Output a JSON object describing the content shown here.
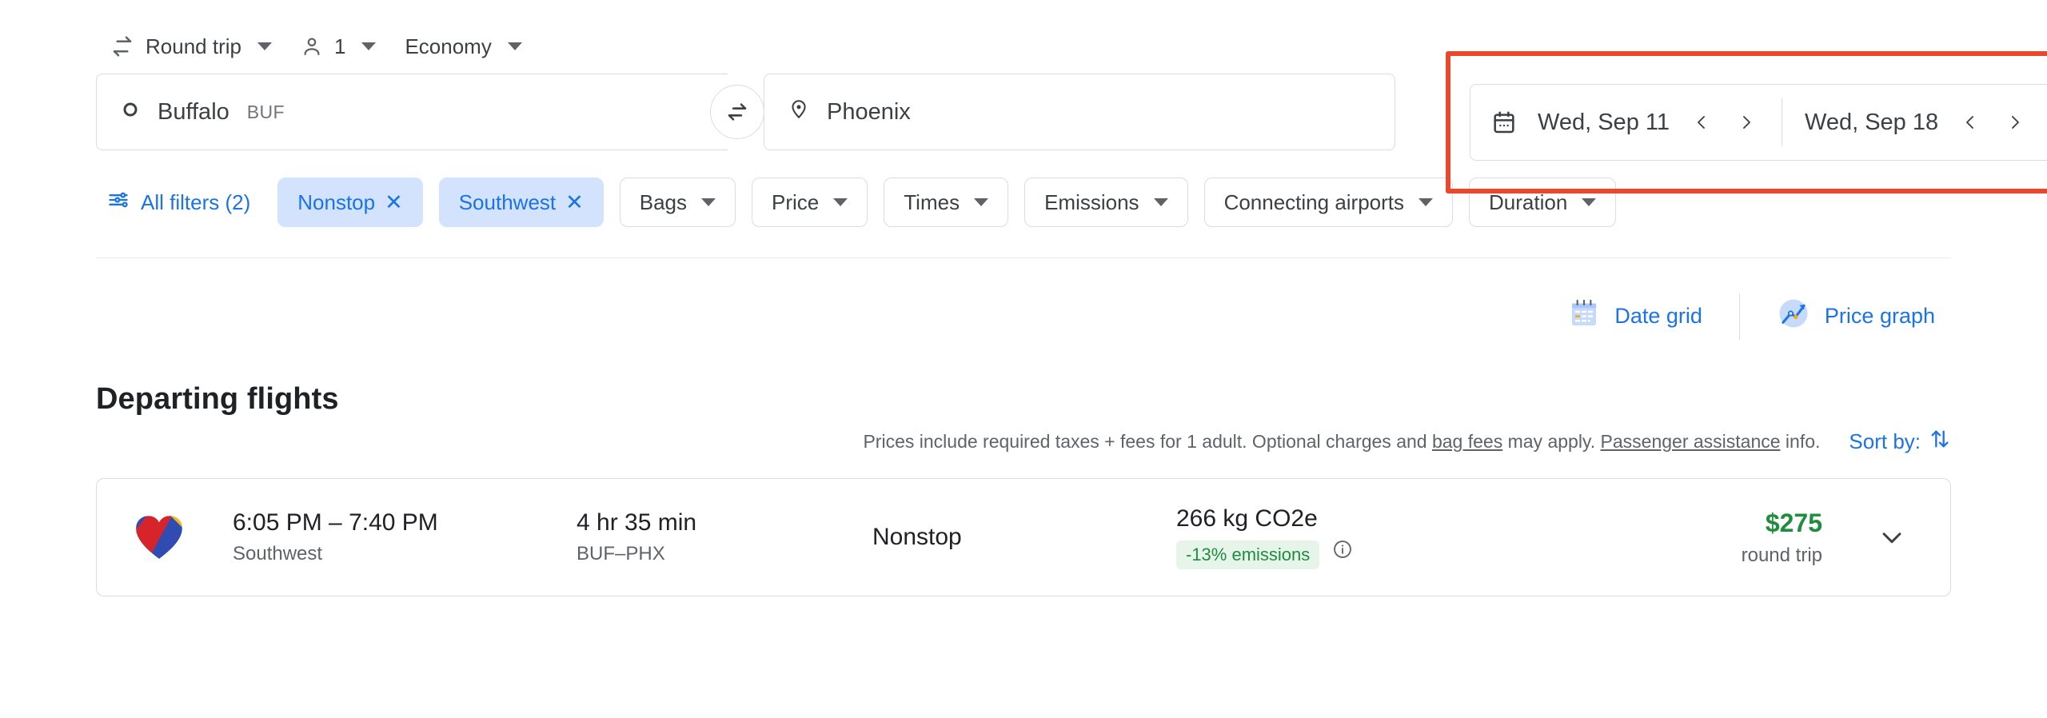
{
  "options": {
    "trip_type": {
      "label": "Round trip",
      "icon": "swap-horizontal-icon"
    },
    "passengers": {
      "label": "1",
      "icon": "person-icon"
    },
    "cabin_class": {
      "label": "Economy"
    }
  },
  "search": {
    "origin": {
      "city": "Buffalo",
      "code": "BUF",
      "icon": "circle-icon"
    },
    "destination": {
      "city": "Phoenix",
      "code": "",
      "icon": "location-pin-icon"
    },
    "swap_label": "swap-icon",
    "dates": {
      "highlighted": true,
      "highlight_color": "#e8482b",
      "calendar_icon": "calendar-icon",
      "depart": "Wed, Sep 11",
      "return": "Wed, Sep 18",
      "prev_icon": "chevron-left-icon",
      "next_icon": "chevron-right-icon"
    }
  },
  "filters": {
    "all_filters": "All filters (2)",
    "chips": [
      {
        "label": "Nonstop",
        "active": true,
        "removable": true
      },
      {
        "label": "Southwest",
        "active": true,
        "removable": true
      },
      {
        "label": "Bags",
        "active": false,
        "removable": false
      },
      {
        "label": "Price",
        "active": false,
        "removable": false
      },
      {
        "label": "Times",
        "active": false,
        "removable": false
      },
      {
        "label": "Emissions",
        "active": false,
        "removable": false
      },
      {
        "label": "Connecting airports",
        "active": false,
        "removable": false
      },
      {
        "label": "Duration",
        "active": false,
        "removable": false
      }
    ]
  },
  "views": {
    "date_grid": "Date grid",
    "price_graph": "Price graph"
  },
  "results": {
    "heading": "Departing flights",
    "disclaimer_1": "Prices include required taxes + fees for 1 adult. Optional charges and ",
    "disclaimer_link_1": "bag fees",
    "disclaimer_2": " may apply. ",
    "disclaimer_link_2": "Passenger assistance",
    "disclaimer_3": " info.",
    "sort_by": "Sort by:",
    "flights": [
      {
        "airline_logo": "southwest-heart-logo",
        "times": "6:05 PM – 7:40 PM",
        "airline": "Southwest",
        "duration": "4 hr 35 min",
        "route": "BUF–PHX",
        "stops": "Nonstop",
        "emissions": "266 kg CO2e",
        "emissions_delta": "-13% emissions",
        "price": "$275",
        "price_type": "round trip"
      }
    ]
  },
  "colors": {
    "accent_blue": "#1a73e8",
    "chip_active_bg": "#d3e3fd",
    "price_green": "#1e8e3e",
    "emissions_bg": "#e6f4ea",
    "highlight_red": "#e8482b"
  }
}
